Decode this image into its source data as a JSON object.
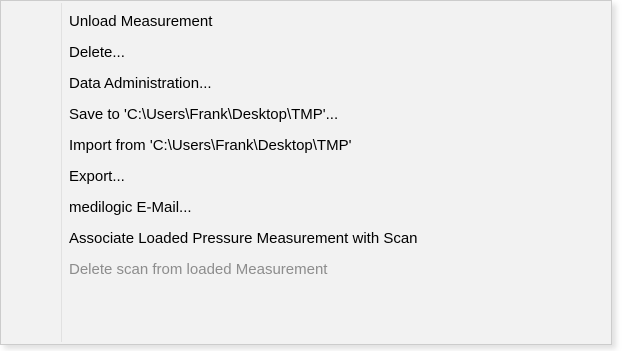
{
  "context_menu": {
    "items": [
      {
        "label": "Unload Measurement",
        "enabled": true
      },
      {
        "label": "Delete...",
        "enabled": true
      },
      {
        "label": "Data Administration...",
        "enabled": true
      },
      {
        "label": "Save to 'C:\\Users\\Frank\\Desktop\\TMP'...",
        "enabled": true
      },
      {
        "label": "Import from 'C:\\Users\\Frank\\Desktop\\TMP'",
        "enabled": true
      },
      {
        "label": "Export...",
        "enabled": true
      },
      {
        "label": "medilogic E-Mail...",
        "enabled": true
      },
      {
        "label": "Associate Loaded Pressure Measurement with Scan",
        "enabled": true
      },
      {
        "label": "Delete scan from loaded Measurement",
        "enabled": false
      }
    ],
    "colors": {
      "background": "#f2f2f2",
      "border": "#cccccc",
      "text": "#000000",
      "disabled_text": "#8d8d8d",
      "hover": "#91c9f7"
    }
  }
}
